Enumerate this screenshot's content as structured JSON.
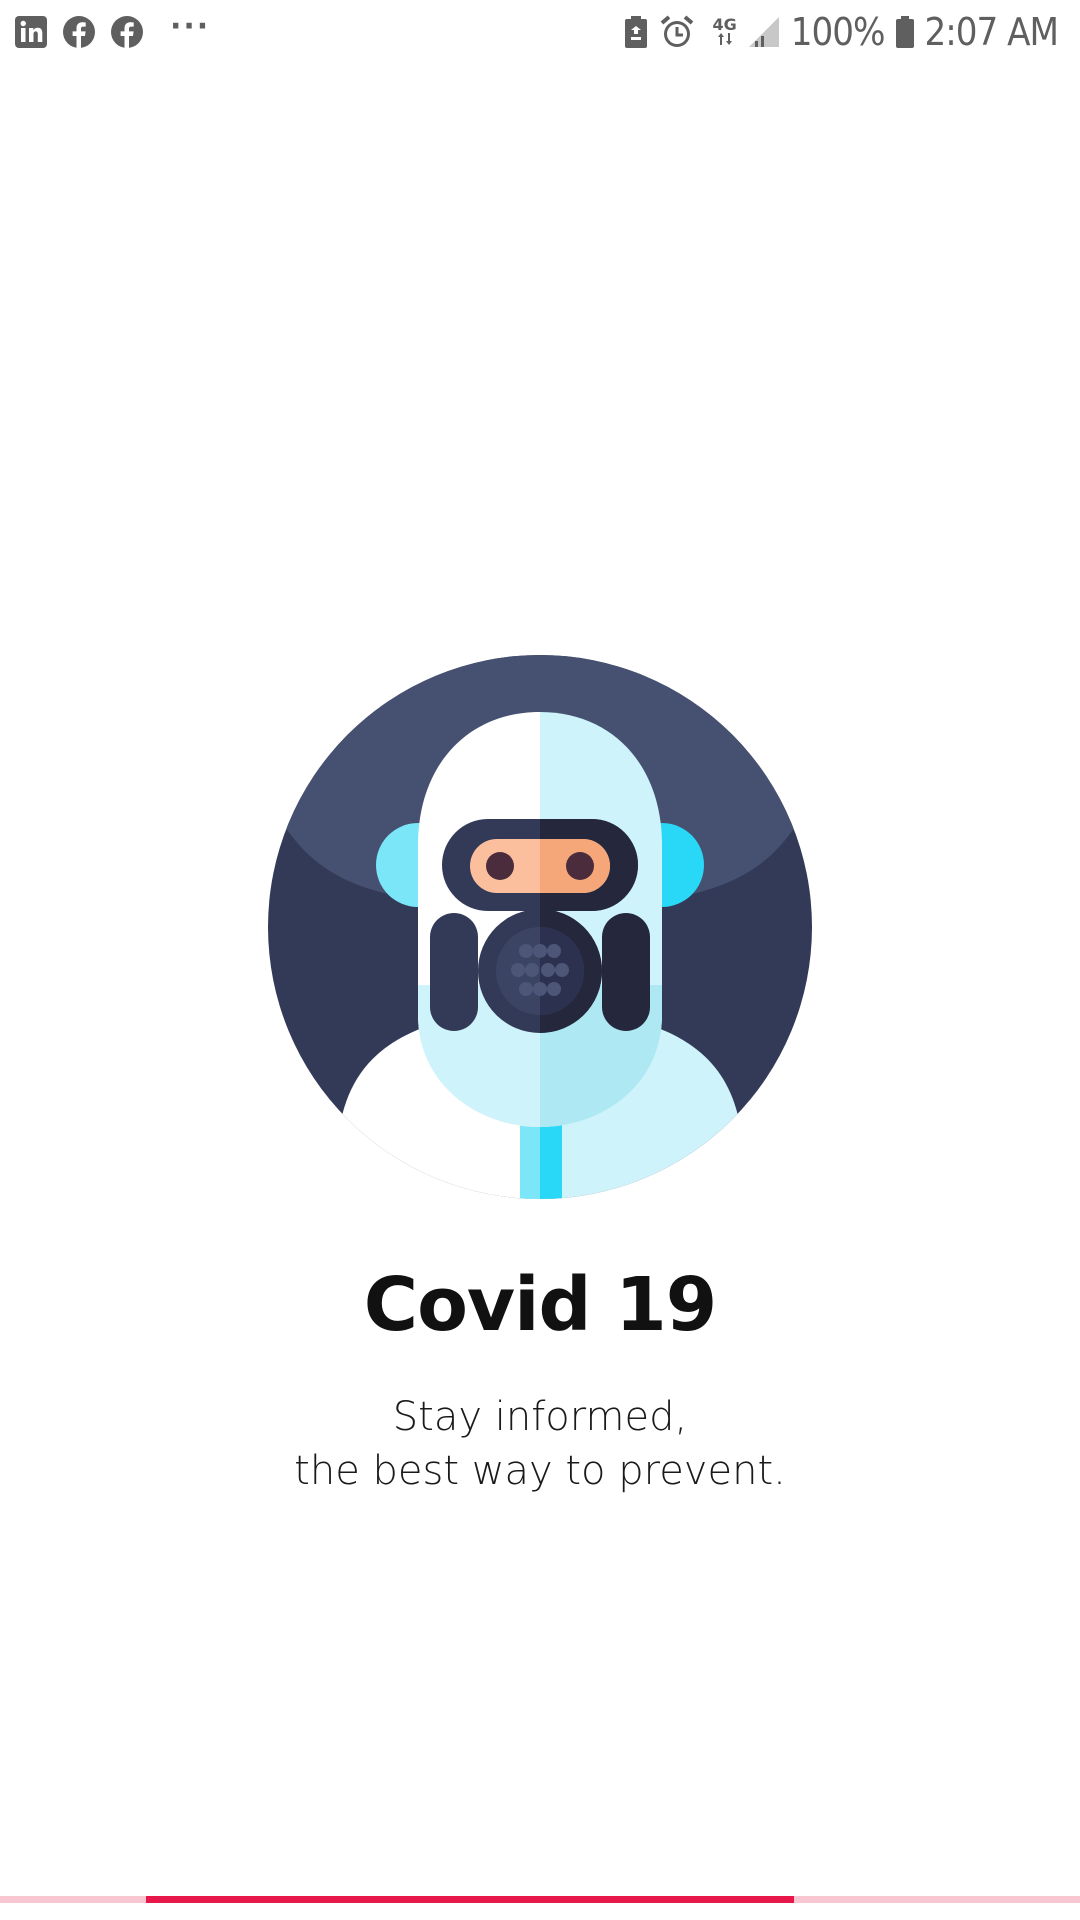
{
  "status_bar": {
    "left_icons": [
      "linkedin-icon",
      "facebook-icon",
      "facebook-icon"
    ],
    "overflow": "···",
    "network": "4G",
    "battery_percent": "100%",
    "time": "2:07 AM"
  },
  "splash": {
    "title": "Covid 19",
    "subtitle_line1": "Stay informed,",
    "subtitle_line2": "the best way to prevent."
  },
  "progress": {
    "value_fraction": 0.6
  },
  "colors": {
    "accent": "#e8174a",
    "track": "#f7c6d1",
    "circle_dark": "#323a57",
    "circle_light": "#465070",
    "suit_white": "#ffffff",
    "suit_light_blue": "#cff3fb",
    "suit_cyan": "#29d8f7"
  }
}
